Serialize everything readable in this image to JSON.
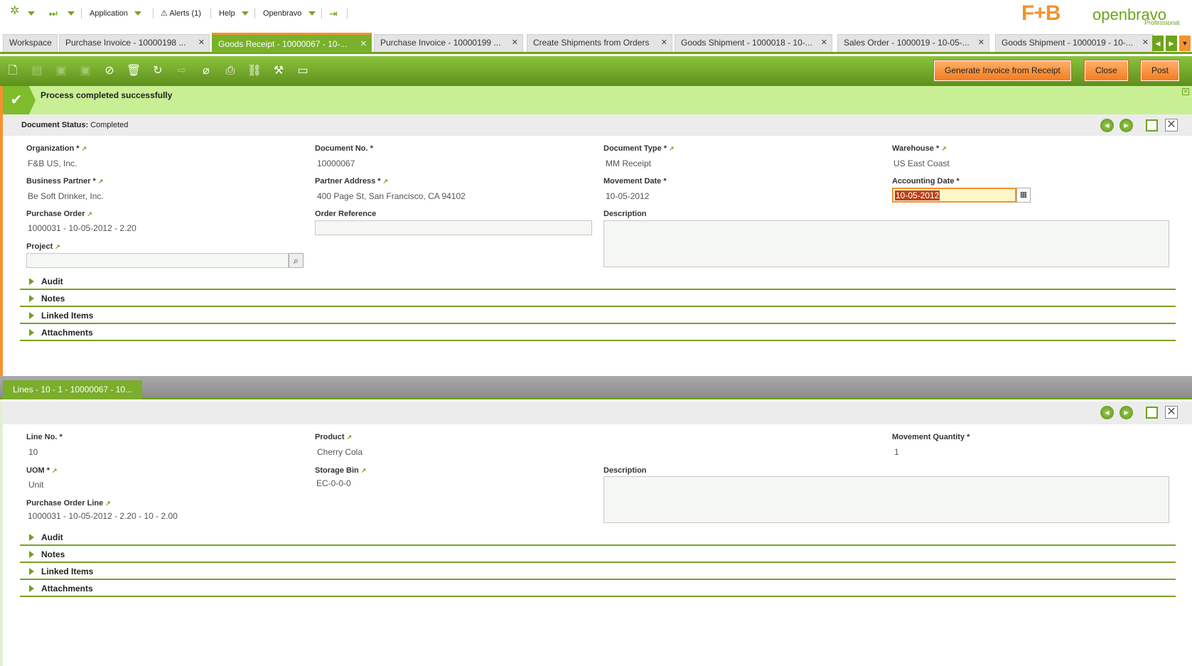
{
  "topbar": {
    "application": "Application",
    "alerts": "Alerts (1)",
    "help": "Help",
    "user": "Openbravo",
    "logo_fb": "F+B",
    "logo_ob": "openbravo",
    "logo_sub": "Professional"
  },
  "tabs": [
    {
      "label": "Workspace"
    },
    {
      "label": "Purchase Invoice - 10000198 ..."
    },
    {
      "label": "Goods Receipt - 10000067 - 10-..."
    },
    {
      "label": "Purchase Invoice - 10000199 ..."
    },
    {
      "label": "Create Shipments from Orders"
    },
    {
      "label": "Goods Shipment - 1000018 - 10-..."
    },
    {
      "label": "Sales Order - 1000019 - 10-05-..."
    },
    {
      "label": "Goods Shipment - 1000019 - 10-..."
    }
  ],
  "buttons": {
    "generate": "Generate Invoice from Receipt",
    "close": "Close",
    "post": "Post"
  },
  "message": "Process completed successfully",
  "status": {
    "label": "Document Status:",
    "value": "Completed"
  },
  "header": {
    "organization": {
      "label": "Organization *",
      "value": "F&B US, Inc."
    },
    "document_no": {
      "label": "Document No. *",
      "value": "10000067"
    },
    "document_type": {
      "label": "Document Type *",
      "value": "MM Receipt"
    },
    "warehouse": {
      "label": "Warehouse *",
      "value": "US East Coast"
    },
    "business_partner": {
      "label": "Business Partner *",
      "value": "Be Soft Drinker, Inc."
    },
    "partner_address": {
      "label": "Partner Address *",
      "value": "400 Page St, San Francisco, CA 94102"
    },
    "movement_date": {
      "label": "Movement Date *",
      "value": "10-05-2012"
    },
    "accounting_date": {
      "label": "Accounting Date *",
      "value": "10-05-2012"
    },
    "purchase_order": {
      "label": "Purchase Order",
      "value": "1000031 - 10-05-2012 - 2.20"
    },
    "order_reference": {
      "label": "Order Reference",
      "value": ""
    },
    "description": {
      "label": "Description",
      "value": ""
    },
    "project": {
      "label": "Project",
      "value": ""
    }
  },
  "sections": [
    "Audit",
    "Notes",
    "Linked Items",
    "Attachments"
  ],
  "lines": {
    "tab": "Lines - 10 - 1 - 10000067 - 10...",
    "line_no": {
      "label": "Line No. *",
      "value": "10"
    },
    "product": {
      "label": "Product",
      "value": "Cherry Cola"
    },
    "movement_qty": {
      "label": "Movement Quantity *",
      "value": "1"
    },
    "uom": {
      "label": "UOM *",
      "value": "Unit"
    },
    "storage_bin": {
      "label": "Storage Bin",
      "value": "EC-0-0-0"
    },
    "description": {
      "label": "Description",
      "value": ""
    },
    "po_line": {
      "label": "Purchase Order Line",
      "value": "1000031 - 10-05-2012 - 2.20 - 10 - 2.00"
    }
  },
  "colors": {
    "accent_green": "#6ea31c",
    "accent_orange": "#f3922f",
    "success_bg": "#c9ef95"
  }
}
